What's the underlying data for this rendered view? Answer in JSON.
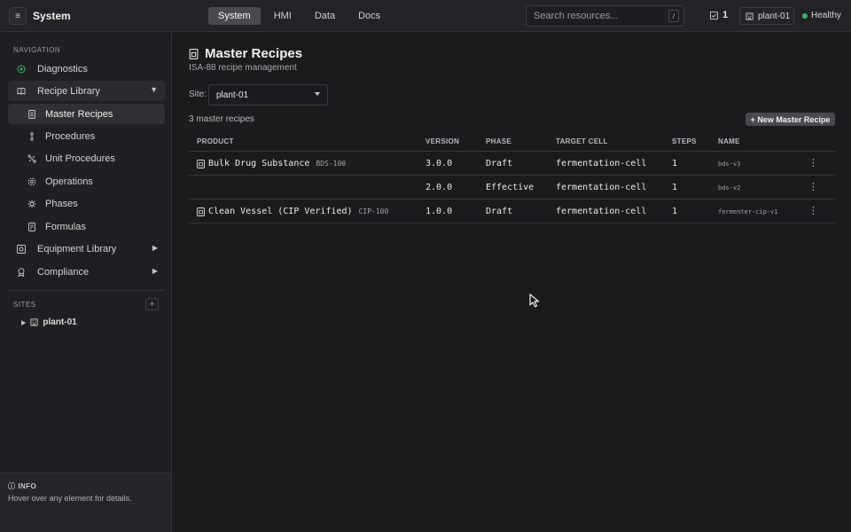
{
  "topbar": {
    "menu_icon": "hamburger-icon",
    "app_title": "System",
    "tabs": [
      "System",
      "HMI",
      "Data",
      "Docs"
    ],
    "active_tab": "System",
    "search_placeholder": "Search resources...",
    "search_shortcut": "/",
    "task_count": "1",
    "site": "plant-01",
    "health": "Healthy",
    "health_color": "#3fb26b"
  },
  "sidebar": {
    "navigation_label": "NAVIGATION",
    "items": [
      {
        "label": "Diagnostics",
        "icon": "diagnostics-icon"
      },
      {
        "label": "Recipe Library",
        "icon": "book-icon"
      },
      {
        "label": "Master Recipes",
        "icon": "recipe-icon"
      },
      {
        "label": "Procedures",
        "icon": "procedures-icon"
      },
      {
        "label": "Unit Procedures",
        "icon": "unit-procedures-icon"
      },
      {
        "label": "Operations",
        "icon": "operations-icon"
      },
      {
        "label": "Phases",
        "icon": "phases-icon"
      },
      {
        "label": "Formulas",
        "icon": "formulas-icon"
      },
      {
        "label": "Equipment Library",
        "icon": "equipment-icon"
      },
      {
        "label": "Compliance",
        "icon": "compliance-icon"
      }
    ],
    "sites_label": "SITES",
    "add_site_label": "+",
    "sites": [
      "plant-01"
    ],
    "info_title": "INFO",
    "info_text": "Hover over any element for details."
  },
  "main": {
    "title": "Master Recipes",
    "subtitle": "ISA-88 recipe management",
    "site_label": "Site:",
    "site_value": "plant-01",
    "count_text": "3 master recipes",
    "new_button": "+ New Master Recipe",
    "columns": [
      "PRODUCT",
      "VERSION",
      "PHASE",
      "TARGET CELL",
      "STEPS",
      "NAME"
    ],
    "rows": [
      {
        "product": "Bulk Drug Substance",
        "code": "BDS-100",
        "version": "3.0.0",
        "phase": "Draft",
        "target_cell": "fermentation-cell",
        "steps": "1",
        "name": "bds-v3"
      },
      {
        "product": "",
        "code": "",
        "version": "2.0.0",
        "phase": "Effective",
        "target_cell": "fermentation-cell",
        "steps": "1",
        "name": "bds-v2"
      },
      {
        "product": "Clean Vessel (CIP Verified)",
        "code": "CIP-100",
        "version": "1.0.0",
        "phase": "Draft",
        "target_cell": "fermentation-cell",
        "steps": "1",
        "name": "fermenter-cip-v1"
      }
    ],
    "row_menu_icon": "kebab-menu-icon"
  }
}
